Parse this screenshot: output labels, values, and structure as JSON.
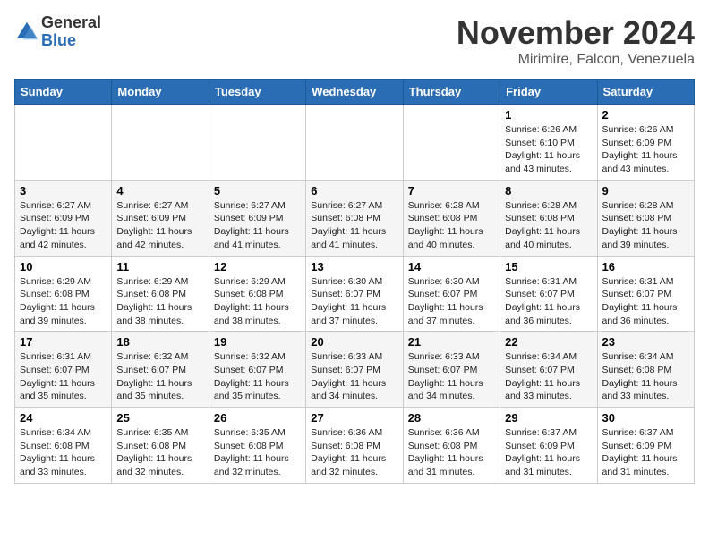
{
  "header": {
    "logo_general": "General",
    "logo_blue": "Blue",
    "month_title": "November 2024",
    "location": "Mirimire, Falcon, Venezuela"
  },
  "weekdays": [
    "Sunday",
    "Monday",
    "Tuesday",
    "Wednesday",
    "Thursday",
    "Friday",
    "Saturday"
  ],
  "weeks": [
    [
      {
        "day": "",
        "info": ""
      },
      {
        "day": "",
        "info": ""
      },
      {
        "day": "",
        "info": ""
      },
      {
        "day": "",
        "info": ""
      },
      {
        "day": "",
        "info": ""
      },
      {
        "day": "1",
        "info": "Sunrise: 6:26 AM\nSunset: 6:10 PM\nDaylight: 11 hours and 43 minutes."
      },
      {
        "day": "2",
        "info": "Sunrise: 6:26 AM\nSunset: 6:09 PM\nDaylight: 11 hours and 43 minutes."
      }
    ],
    [
      {
        "day": "3",
        "info": "Sunrise: 6:27 AM\nSunset: 6:09 PM\nDaylight: 11 hours and 42 minutes."
      },
      {
        "day": "4",
        "info": "Sunrise: 6:27 AM\nSunset: 6:09 PM\nDaylight: 11 hours and 42 minutes."
      },
      {
        "day": "5",
        "info": "Sunrise: 6:27 AM\nSunset: 6:09 PM\nDaylight: 11 hours and 41 minutes."
      },
      {
        "day": "6",
        "info": "Sunrise: 6:27 AM\nSunset: 6:08 PM\nDaylight: 11 hours and 41 minutes."
      },
      {
        "day": "7",
        "info": "Sunrise: 6:28 AM\nSunset: 6:08 PM\nDaylight: 11 hours and 40 minutes."
      },
      {
        "day": "8",
        "info": "Sunrise: 6:28 AM\nSunset: 6:08 PM\nDaylight: 11 hours and 40 minutes."
      },
      {
        "day": "9",
        "info": "Sunrise: 6:28 AM\nSunset: 6:08 PM\nDaylight: 11 hours and 39 minutes."
      }
    ],
    [
      {
        "day": "10",
        "info": "Sunrise: 6:29 AM\nSunset: 6:08 PM\nDaylight: 11 hours and 39 minutes."
      },
      {
        "day": "11",
        "info": "Sunrise: 6:29 AM\nSunset: 6:08 PM\nDaylight: 11 hours and 38 minutes."
      },
      {
        "day": "12",
        "info": "Sunrise: 6:29 AM\nSunset: 6:08 PM\nDaylight: 11 hours and 38 minutes."
      },
      {
        "day": "13",
        "info": "Sunrise: 6:30 AM\nSunset: 6:07 PM\nDaylight: 11 hours and 37 minutes."
      },
      {
        "day": "14",
        "info": "Sunrise: 6:30 AM\nSunset: 6:07 PM\nDaylight: 11 hours and 37 minutes."
      },
      {
        "day": "15",
        "info": "Sunrise: 6:31 AM\nSunset: 6:07 PM\nDaylight: 11 hours and 36 minutes."
      },
      {
        "day": "16",
        "info": "Sunrise: 6:31 AM\nSunset: 6:07 PM\nDaylight: 11 hours and 36 minutes."
      }
    ],
    [
      {
        "day": "17",
        "info": "Sunrise: 6:31 AM\nSunset: 6:07 PM\nDaylight: 11 hours and 35 minutes."
      },
      {
        "day": "18",
        "info": "Sunrise: 6:32 AM\nSunset: 6:07 PM\nDaylight: 11 hours and 35 minutes."
      },
      {
        "day": "19",
        "info": "Sunrise: 6:32 AM\nSunset: 6:07 PM\nDaylight: 11 hours and 35 minutes."
      },
      {
        "day": "20",
        "info": "Sunrise: 6:33 AM\nSunset: 6:07 PM\nDaylight: 11 hours and 34 minutes."
      },
      {
        "day": "21",
        "info": "Sunrise: 6:33 AM\nSunset: 6:07 PM\nDaylight: 11 hours and 34 minutes."
      },
      {
        "day": "22",
        "info": "Sunrise: 6:34 AM\nSunset: 6:07 PM\nDaylight: 11 hours and 33 minutes."
      },
      {
        "day": "23",
        "info": "Sunrise: 6:34 AM\nSunset: 6:08 PM\nDaylight: 11 hours and 33 minutes."
      }
    ],
    [
      {
        "day": "24",
        "info": "Sunrise: 6:34 AM\nSunset: 6:08 PM\nDaylight: 11 hours and 33 minutes."
      },
      {
        "day": "25",
        "info": "Sunrise: 6:35 AM\nSunset: 6:08 PM\nDaylight: 11 hours and 32 minutes."
      },
      {
        "day": "26",
        "info": "Sunrise: 6:35 AM\nSunset: 6:08 PM\nDaylight: 11 hours and 32 minutes."
      },
      {
        "day": "27",
        "info": "Sunrise: 6:36 AM\nSunset: 6:08 PM\nDaylight: 11 hours and 32 minutes."
      },
      {
        "day": "28",
        "info": "Sunrise: 6:36 AM\nSunset: 6:08 PM\nDaylight: 11 hours and 31 minutes."
      },
      {
        "day": "29",
        "info": "Sunrise: 6:37 AM\nSunset: 6:09 PM\nDaylight: 11 hours and 31 minutes."
      },
      {
        "day": "30",
        "info": "Sunrise: 6:37 AM\nSunset: 6:09 PM\nDaylight: 11 hours and 31 minutes."
      }
    ]
  ]
}
